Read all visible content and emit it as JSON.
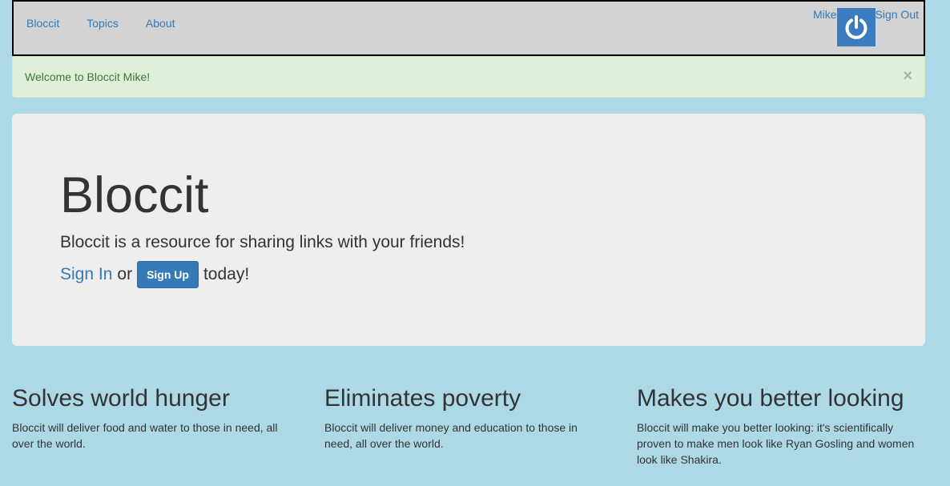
{
  "nav": {
    "links": [
      "Bloccit",
      "Topics",
      "About"
    ],
    "user_name": "Mike",
    "sign_out": "Sign Out",
    "avatar_icon": "power-icon",
    "avatar_color": "#3b7bbf"
  },
  "alert": {
    "message": "Welcome to Bloccit Mike!",
    "close_symbol": "×"
  },
  "jumbotron": {
    "title": "Bloccit",
    "lead": "Bloccit is a resource for sharing links with your friends!",
    "sign_in": "Sign In",
    "or": "or",
    "sign_up": "Sign Up",
    "today": "today!"
  },
  "features": [
    {
      "title": "Solves world hunger",
      "text": "Bloccit will deliver food and water to those in need, all over the world."
    },
    {
      "title": "Eliminates poverty",
      "text": "Bloccit will deliver money and education to those in need, all over the world."
    },
    {
      "title": "Makes you better looking",
      "text": "Bloccit will make you better looking: it's scientifically proven to make men look like Ryan Gosling and women look like Shakira."
    }
  ],
  "colors": {
    "background": "#add8e6",
    "navbar": "#d3d3d3",
    "link": "#337ab7",
    "alert_bg": "#dff0d8",
    "alert_text": "#3c763d",
    "jumbotron_bg": "#eeeeee"
  }
}
